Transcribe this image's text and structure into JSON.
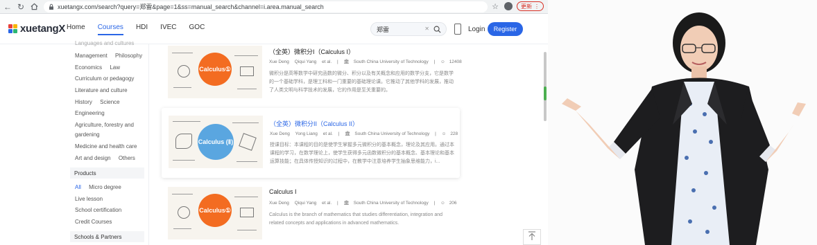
{
  "browser": {
    "url": "xuetangx.com/search?query=郑雷&page=1&ss=manual_search&channel=i.area.manual_search",
    "update_label": "更新"
  },
  "header": {
    "logo_text": "xuetangX",
    "nav": [
      "Home",
      "Courses",
      "HDI",
      "IVEC",
      "GOC"
    ],
    "active_nav": "Courses",
    "search_value": "郑雷",
    "login_label": "Login",
    "register_label": "Register"
  },
  "sidebar": {
    "subjects_rows": [
      [
        "Languages and cultures"
      ],
      [
        "Management",
        "Philosophy"
      ],
      [
        "Economics",
        "Law"
      ],
      [
        "Curriculum or pedagogy"
      ],
      [
        "Literature and culture"
      ],
      [
        "History",
        "Science"
      ],
      [
        "Engineering"
      ],
      [
        "Agriculture, forestry and"
      ],
      [
        "gardening"
      ],
      [
        "Medicine and health care"
      ],
      [
        "Art and design",
        "Others"
      ]
    ],
    "products_header": "Products",
    "products_rows": [
      [
        "All",
        "Micro degree"
      ],
      [
        "Live lesson"
      ],
      [
        "School certification"
      ],
      [
        "Credit Courses"
      ]
    ],
    "products_selected": "All",
    "schools_header": "Schools & Partners"
  },
  "courses": [
    {
      "title": "（全英）微积分I（Calculus I）",
      "thumb_label": "Calculus①",
      "teachers": [
        "Xue Deng",
        "Qiqui Yang",
        "et al."
      ],
      "school": "South China University of Technology",
      "enrolled": "12408",
      "description": "微积分是高等数学中研究函数的微分、积分以及有关概念和应用的数学分支，它是数学的一个基础学科，是理工科和一门重要的基础理论课。它推动了其他学科的发展，推动了人类文明与科学技术的发展，它的作用是至关重要的。"
    },
    {
      "title": "（全英）微积分II（Calculus II）",
      "thumb_label": "Calculus (Ⅱ)",
      "teachers": [
        "Xue Deng",
        "Yong Liang",
        "et al."
      ],
      "school": "South China University of Technology",
      "enrolled": "228",
      "description": "授课目标：本课程的目的是使学生掌握多元微积分的基本概念，理论及其应用。通过本课程的学习，在数学理论上，使学生获得多元函数微积分的基本概念、基本理论和基本运算技能；在具体传授知识的过程中，在教学中注意培养学生抽象思维能力，i..."
    },
    {
      "title": "Calculus I",
      "thumb_label": "Calculus①",
      "teachers": [
        "Xue Deng",
        "Qiqui Yang",
        "et al."
      ],
      "school": "South China University of Technology",
      "enrolled": "206",
      "description": "Calculus is the branch of mathematics that studies differentiation, integration and related concepts and applications in advanced mathematics."
    }
  ],
  "colors": {
    "accent": "#2a66e6",
    "calc1_circle": "#f36c21",
    "calc2_circle": "#5aa6e0",
    "blazer": "#1d1d1f"
  }
}
